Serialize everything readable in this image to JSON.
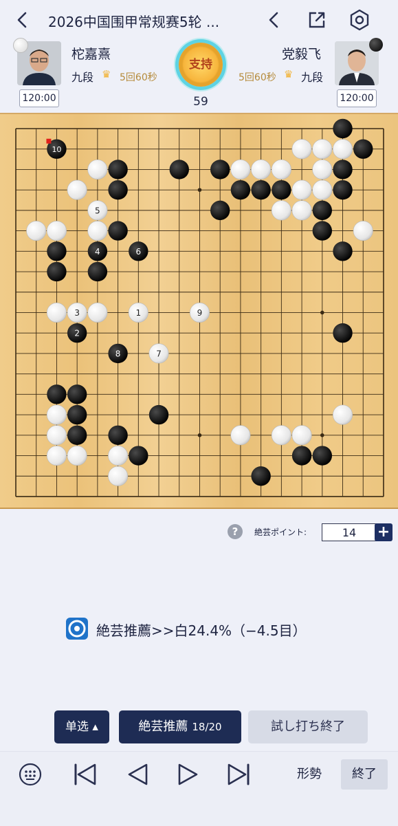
{
  "header": {
    "title": "2026中国围甲常规赛5轮 ...",
    "back_icon": "chevron-left-icon",
    "prev_icon": "chevron-left-icon",
    "share_icon": "share-icon",
    "settings_icon": "hexagon-settings-icon"
  },
  "players": {
    "white": {
      "name": "柁嘉熹",
      "rank": "九段",
      "time_control": "5回60秒",
      "clock": "120:00",
      "stone": "white"
    },
    "black": {
      "name": "党毅飞",
      "rank": "九段",
      "time_control": "5回60秒",
      "clock": "120:00",
      "stone": "black"
    }
  },
  "support_label": "支持",
  "move_number": "59",
  "board": {
    "size": 19,
    "last_move_marker": "red-square",
    "black_stones": [
      [
        16,
        0
      ],
      [
        2,
        1
      ],
      [
        17,
        1
      ],
      [
        5,
        2
      ],
      [
        8,
        2
      ],
      [
        10,
        2
      ],
      [
        16,
        2
      ],
      [
        5,
        3
      ],
      [
        11,
        3
      ],
      [
        12,
        3
      ],
      [
        13,
        3
      ],
      [
        16,
        3
      ],
      [
        10,
        4
      ],
      [
        15,
        4
      ],
      [
        5,
        5
      ],
      [
        15,
        5
      ],
      [
        2,
        6
      ],
      [
        4,
        6
      ],
      [
        6,
        6
      ],
      [
        16,
        6
      ],
      [
        2,
        7
      ],
      [
        4,
        7
      ],
      [
        3,
        10
      ],
      [
        16,
        10
      ],
      [
        5,
        11
      ],
      [
        2,
        13
      ],
      [
        3,
        13
      ],
      [
        3,
        14
      ],
      [
        7,
        14
      ],
      [
        3,
        15
      ],
      [
        5,
        15
      ],
      [
        6,
        16
      ],
      [
        14,
        16
      ],
      [
        15,
        16
      ],
      [
        12,
        17
      ]
    ],
    "white_stones": [
      [
        14,
        1
      ],
      [
        15,
        1
      ],
      [
        16,
        1
      ],
      [
        4,
        2
      ],
      [
        11,
        2
      ],
      [
        12,
        2
      ],
      [
        13,
        2
      ],
      [
        15,
        2
      ],
      [
        3,
        3
      ],
      [
        14,
        3
      ],
      [
        15,
        3
      ],
      [
        4,
        4
      ],
      [
        13,
        4
      ],
      [
        14,
        4
      ],
      [
        1,
        5
      ],
      [
        2,
        5
      ],
      [
        4,
        5
      ],
      [
        17,
        5
      ],
      [
        2,
        9
      ],
      [
        3,
        9
      ],
      [
        4,
        9
      ],
      [
        6,
        9
      ],
      [
        9,
        9
      ],
      [
        7,
        11
      ],
      [
        2,
        14
      ],
      [
        16,
        14
      ],
      [
        2,
        15
      ],
      [
        11,
        15
      ],
      [
        13,
        15
      ],
      [
        14,
        15
      ],
      [
        2,
        16
      ],
      [
        3,
        16
      ],
      [
        5,
        16
      ],
      [
        5,
        17
      ]
    ],
    "labels": [
      {
        "pos": [
          6,
          9
        ],
        "text": "1"
      },
      {
        "pos": [
          3,
          10
        ],
        "text": "2"
      },
      {
        "pos": [
          3,
          9
        ],
        "text": "3"
      },
      {
        "pos": [
          4,
          6
        ],
        "text": "4"
      },
      {
        "pos": [
          4,
          4
        ],
        "text": "5"
      },
      {
        "pos": [
          6,
          6
        ],
        "text": "6"
      },
      {
        "pos": [
          7,
          11
        ],
        "text": "7"
      },
      {
        "pos": [
          5,
          11
        ],
        "text": "8"
      },
      {
        "pos": [
          9,
          9
        ],
        "text": "9"
      },
      {
        "pos": [
          2,
          1
        ],
        "text": "10"
      }
    ],
    "last_move": [
      2,
      1
    ]
  },
  "points": {
    "label": "絶芸ポイント:",
    "value": "14",
    "help_icon": "question-circle-icon",
    "plus_icon": "plus-icon"
  },
  "recommendation": {
    "icon": "jueyi-logo-icon",
    "text": "絶芸推薦>>白24.4%（−4.5目）"
  },
  "buttons": {
    "single_select": "单选 ▴",
    "recommend": "絶芸推薦",
    "recommend_count": "18/20",
    "trial_end": "試し打ち終了"
  },
  "bottom_nav": {
    "keypad_icon": "keypad-circle-icon",
    "first_icon": "skip-to-start-icon",
    "prev_icon": "triangle-left-icon",
    "next_icon": "triangle-right-icon",
    "last_icon": "skip-to-end-icon",
    "situation": "形勢",
    "end": "終了"
  }
}
